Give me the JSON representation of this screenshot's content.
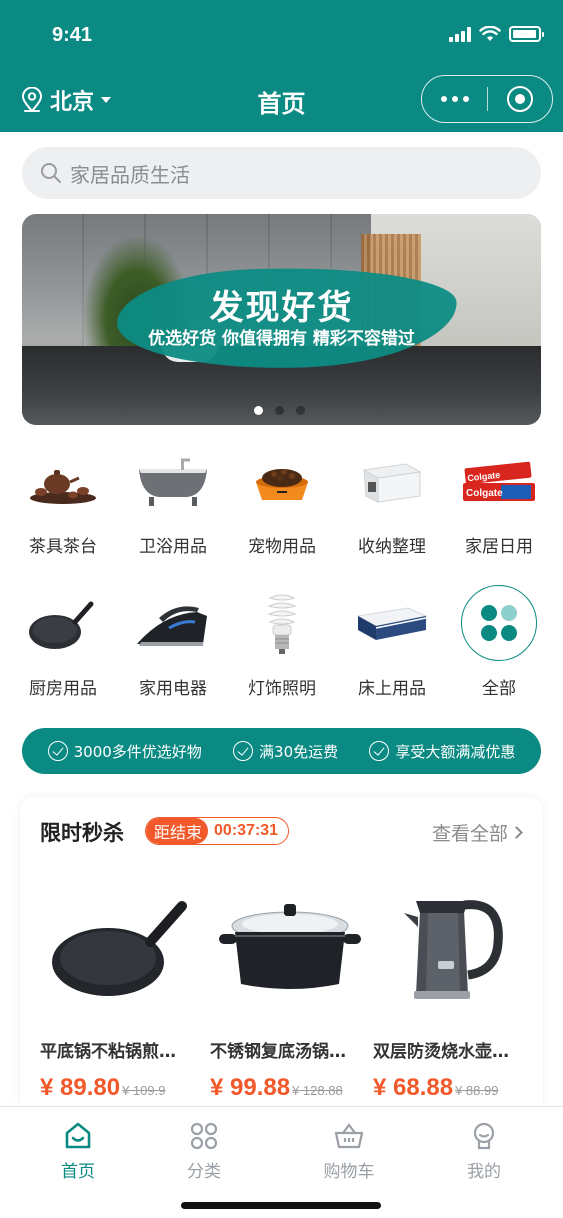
{
  "status_bar": {
    "time": "9:41"
  },
  "header": {
    "location": "北京",
    "title": "首页"
  },
  "search": {
    "placeholder": "家居品质生活"
  },
  "banner": {
    "title": "发现好货",
    "subtitle": "优选好货 你值得拥有 精彩不容错过",
    "slide_count": 3,
    "active_slide": 1
  },
  "categories": [
    {
      "label": "茶具茶台",
      "icon": "tea-set-icon"
    },
    {
      "label": "卫浴用品",
      "icon": "bathtub-icon"
    },
    {
      "label": "宠物用品",
      "icon": "pet-bowl-icon"
    },
    {
      "label": "收纳整理",
      "icon": "storage-box-icon"
    },
    {
      "label": "家居日用",
      "icon": "toothpaste-icon"
    },
    {
      "label": "厨房用品",
      "icon": "frying-pan-icon"
    },
    {
      "label": "家用电器",
      "icon": "iron-icon"
    },
    {
      "label": "灯饰照明",
      "icon": "light-bulb-icon"
    },
    {
      "label": "床上用品",
      "icon": "mattress-icon"
    },
    {
      "label": "全部",
      "icon": "all-categories-icon"
    }
  ],
  "promo": {
    "items": [
      "3000多件优选好物",
      "满30免运费",
      "享受大额满减优惠"
    ]
  },
  "flash_sale": {
    "title": "限时秒杀",
    "countdown_label": "距结束",
    "countdown_time": "00:37:31",
    "view_all": "查看全部",
    "products": [
      {
        "name": "平底锅不粘锅煎…",
        "price": "¥ 89.80",
        "original_price": "¥ 109.9",
        "icon": "frying-pan-icon"
      },
      {
        "name": "不锈钢复底汤锅…",
        "price": "¥ 99.88",
        "original_price": "¥ 128.88",
        "icon": "soup-pot-icon"
      },
      {
        "name": "双层防烫烧水壶…",
        "price": "¥ 68.88",
        "original_price": "¥ 88.99",
        "icon": "kettle-icon"
      }
    ]
  },
  "tabbar": {
    "tabs": [
      {
        "label": "首页",
        "icon": "home-icon",
        "active": true
      },
      {
        "label": "分类",
        "icon": "category-icon",
        "active": false
      },
      {
        "label": "购物车",
        "icon": "cart-icon",
        "active": false
      },
      {
        "label": "我的",
        "icon": "profile-icon",
        "active": false
      }
    ]
  },
  "colors": {
    "primary": "#0a8a82",
    "accent": "#f2592a",
    "text": "#333333",
    "muted": "#9aa0a6"
  }
}
